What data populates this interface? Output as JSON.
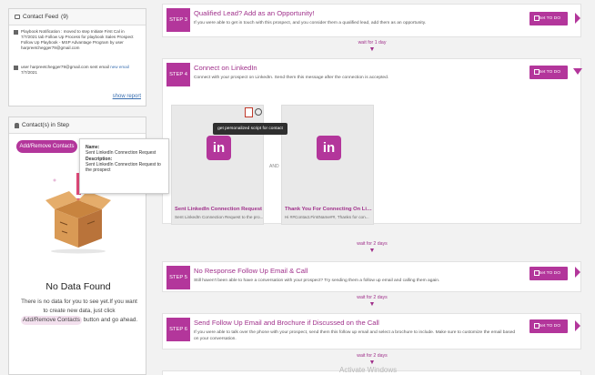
{
  "contact_feed": {
    "title": "Contact Feed",
    "count": "(9)",
    "item1_text": "Playbook Notification : moved to step Initiate First Cal in 7/7/2021 tab Follow Up Process for playbook Sales Prospect Follow Up Playbook - MSP Advantage Program by user harpreetchegger79@gmail.com",
    "item2_prefix": "user harpreetchegger79@gmail.com sent email",
    "item2_link": "new email",
    "item2_date": "7/7/2021",
    "show_report": "show report"
  },
  "contacts_in_step": {
    "title": "Contact(s) in Step",
    "add_button": "Add/Remove Contacts",
    "tooltip": {
      "name_label": "Name:",
      "name_value": "Sent LinkedIn Connection Request",
      "desc_label": "Description:",
      "desc_value": "Sent LinkedIn Connection Request to the prospect"
    },
    "no_data_title": "No Data Found",
    "no_data_part1": "There is no data for you to see yet.If you want to create new data, just click",
    "no_data_pill": "Add/Remove Contacts",
    "no_data_part2": "button and go ahead."
  },
  "steps": [
    {
      "badge": "STEP 3",
      "title": "Qualified Lead? Add as an Opportunity!",
      "desc": "If you were able to get in touch with this prospect, and you consider them a qualified lead, add them as an opportunity.",
      "button": "Set TO DO"
    },
    {
      "badge": "STEP 4",
      "title": "Connect on LinkedIn",
      "desc": "Connect with your prospect on LinkedIn. Send them this message after the connection is accepted.",
      "button": "Set TO DO"
    },
    {
      "badge": "STEP 5",
      "title": "No Response Follow Up Email & Call",
      "desc": "Still haven't been able to have a conversation with your prospect? Try sending them a follow up email and calling them again.",
      "button": "Set TO DO"
    },
    {
      "badge": "STEP 6",
      "title": "Send Follow Up Email and Brochure if Discussed on the Call",
      "desc": "If you were able to talk over the phone with your prospect, send them this follow up email and select a brochure to include. Make sure to customize the email based on your conversation.",
      "button": "Set TO DO"
    }
  ],
  "waits": [
    "wait for 1 day",
    "wait for 2 days",
    "wait for 2 days",
    "wait for 2 days"
  ],
  "cards": [
    {
      "title": "Sent LinkedIn Connection Request",
      "sub": "Sent LinkedIn Connection Request to the pro..."
    },
    {
      "title": "Thank You For Connecting On Lin...",
      "sub": "Hi ##Contact.FirstName##, Thanks for con..."
    }
  ],
  "and_label": "AND",
  "linkedin_glyph": "in",
  "script_tooltip": "get personalized script for contact",
  "watermark": "Activate Windows",
  "colors": {
    "accent": "#b3369b",
    "title": "#a0318b"
  }
}
